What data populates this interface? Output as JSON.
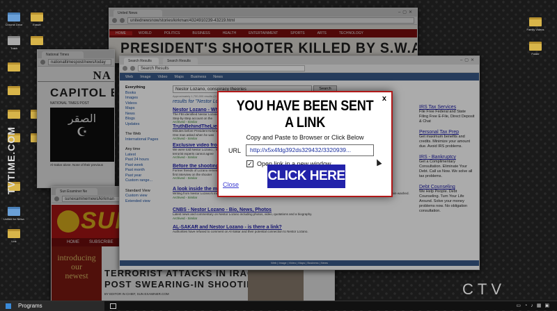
{
  "desktop": {
    "left_icons": [
      "Chrome Drive",
      "Eraser",
      "Trash",
      "",
      "",
      "",
      "",
      "",
      "",
      "",
      "",
      "Unified for Network",
      "Link"
    ],
    "right_icons": [
      "Family Videos",
      "Folder"
    ]
  },
  "watermarks": {
    "left": "TVTIME.COM",
    "right": "CTV"
  },
  "win_news_main": {
    "tab": "United News",
    "url": "unitednewsnow/stories/kirkman/4324910239-43219.html",
    "nav": [
      "HOME",
      "WORLD",
      "POLITICS",
      "BUSINESS",
      "HEALTH",
      "ENTERTAINMENT",
      "SPORTS",
      "ARTS",
      "TECHNOLOGY"
    ],
    "headline": "PRESIDENT'S SHOOTER KILLED BY S.W.A.T"
  },
  "win_national": {
    "tab": "National Times",
    "url": "nationaltimespost/news/today",
    "mast": "NA",
    "headline": "CAPITOL BO",
    "sub": "NATIONAL TIMES POST",
    "emblem_text": "الصقر",
    "caption": "Al-Sakar alone. None of their previous"
  },
  "win_examiner": {
    "tab": "Sun Examiner Ne",
    "url": "sunexaminernews/kirkman",
    "logo": "SUN",
    "nav": [
      "HOME",
      "SUBSCRIBE"
    ],
    "promo": [
      "introducing",
      "our",
      "newest"
    ],
    "headline1": "TERRORIST ATTACKS IN IRAQ SPIKE",
    "headline2": "POST SWEARING-IN SHOOTING",
    "byline": "BY EDITOR IN CHIEF, SUN EXAMINER.COM"
  },
  "win_search": {
    "tab": "Search Results",
    "url": "Search Results",
    "tabs": [
      "Web",
      "Image",
      "Video",
      "Maps",
      "Business",
      "News"
    ],
    "query": "Nestor Lozano, conspiracy theories",
    "search_button": "Search",
    "stats": "Approximately 1,700,000 results (0.17 seconds)",
    "results_for": "results for \"Nestor Lozano",
    "sidebar_top": [
      "Everything",
      "Books",
      "Images",
      "Videos",
      "Maps",
      "News",
      "Blogs",
      "Updates"
    ],
    "sidebar_mid": [
      "The Web",
      "International Pages"
    ],
    "sidebar_time": [
      "Any time",
      "Latest",
      "Past 24 hours",
      "Past week",
      "Past month",
      "Past year",
      "Custom range..."
    ],
    "sidebar_view": [
      "Standard View",
      "Custom view",
      "Extended view"
    ],
    "results": [
      {
        "title": "Nestor Lozano - What",
        "snippet": "The FBI identified Nestor Lozano... A Step-by-Step account on the",
        "url": "Archived - Similar"
      },
      {
        "title": "TruthBehindTheLies",
        "snippet": "Minutes before President Kirkman... One man asked when he was",
        "url": "Archived - Similar"
      },
      {
        "title": "Exclusive video from",
        "snippet": "We were told Nestor Lozano... If terrorist experts cannot agree",
        "url": "Archived - Similar"
      },
      {
        "title": "Before the shooting",
        "snippet": "Former friends of Lozano remember... first interview on the shooter",
        "url": "Archived - Similar"
      },
      {
        "title": "A look inside the mind of Nestor Lozano",
        "snippet": "Writing from Nestor Lozano's military notebooks leaked to us. Find out wht he really thought. Early indoctrinations by extremist ideas show a history of being brain-washed.",
        "url": "Archived - Similar"
      },
      {
        "title": "CNBS - Nestor Lozano - Bio, News, Photos",
        "snippet": "Latest news and commentary on Nestor Lozano including photos, video, quotations and a biography.",
        "url": "Archived - Similar"
      },
      {
        "title": "AL-SAKAR and Nestor Lozano - is there a link?",
        "snippet": "Authorities have refused to comment on Al-Sakar and their potential connection to Nestor Lozano.",
        "url": "Archived - Similar"
      }
    ],
    "footer": "Web | Image | Video | Maps | Business | News",
    "ads": [
      {
        "title": "IRS Tax Services",
        "text": "File Free Federal and State Filing Free E-File, Direct Deposit & Chat"
      },
      {
        "title": "Personal Tax Prep",
        "text": "Get maximum benefits and credits. Minimize your amount due. Avoid IRS problems."
      },
      {
        "title": "IRS - Bankruptcy",
        "text": "Get a Complimentary Consultation. Eliminate Your Debt. Call us Now. We solve all tax problems."
      },
      {
        "title": "Debt Counseling",
        "text": "We Help People. Debt Counseling. Turn Your Life Around. Solve your money problems now. No obligation consultation."
      }
    ]
  },
  "popup": {
    "title": "YOU HAVE BEEN SENT A LINK",
    "close": "x",
    "instruction": "Copy and Paste to Browser or Click Below",
    "url_label": "URL",
    "url_value": "http://x5x4fdg392ds329432/3320939...",
    "checkbox_mark": "✓",
    "checkbox_label": "Open link in a new window",
    "click_button": "CLICK HERE",
    "close_link": "Close"
  },
  "taskbar": {
    "start_label": "Programs"
  }
}
